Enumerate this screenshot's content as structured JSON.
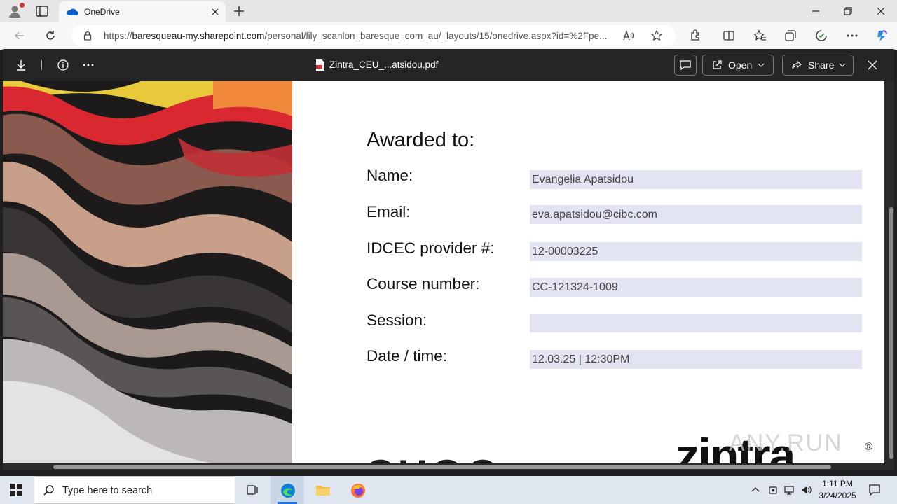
{
  "browser": {
    "tab": {
      "title": "OneDrive"
    },
    "address": {
      "url_prefix": "https://",
      "url_host": "baresqueau-my.sharepoint.com",
      "url_path": "/personal/lily_scanlon_baresque_com_au/_layouts/15/onedrive.aspx?id=%2Fpe..."
    }
  },
  "viewer": {
    "document_title": "Zintra_CEU_...atsidou.pdf",
    "open_label": "Open",
    "share_label": "Share"
  },
  "certificate": {
    "awarded_to": "Awarded to:",
    "fields": [
      {
        "label": "Name:",
        "value": "Evangelia Apatsidou"
      },
      {
        "label": "Email:",
        "value": "eva.apatsidou@cibc.com"
      },
      {
        "label": "IDCEC provider #:",
        "value": "12-00003225"
      },
      {
        "label": "Course number:",
        "value": "CC-121324-1009"
      },
      {
        "label": "Session:",
        "value": ""
      },
      {
        "label": "Date / time:",
        "value": "12.03.25  |  12:30PM"
      }
    ],
    "footer_text": "CHOO",
    "logo": "zintra",
    "logo_mark": "®"
  },
  "watermark": "ANY.RUN",
  "taskbar": {
    "search_placeholder": "Type here to search",
    "time": "1:11 PM",
    "date": "3/24/2025"
  },
  "colors": {
    "field_fill": "#e3e4f2",
    "edge_accent": "#0078d4",
    "viewer_bar": "#252525"
  }
}
